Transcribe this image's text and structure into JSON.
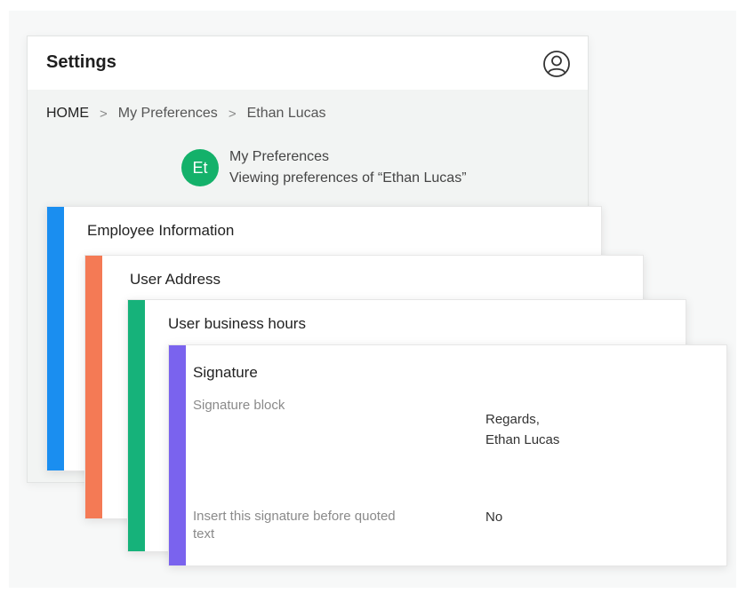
{
  "settings": {
    "title": "Settings"
  },
  "breadcrumb": {
    "items": [
      "HOME",
      "My Preferences",
      "Ethan Lucas"
    ],
    "separator": ">"
  },
  "profile": {
    "initials": "Et",
    "heading": "My Preferences",
    "subtitle": "Viewing preferences of “Ethan Lucas”",
    "avatar_color": "#14b16a"
  },
  "cards": {
    "employee": {
      "title": "Employee Information",
      "accent": "#1a8ef0"
    },
    "address": {
      "title": "User Address",
      "accent": "#f47a55"
    },
    "hours": {
      "title": "User business hours",
      "accent": "#16b27a"
    },
    "signature": {
      "title": "Signature",
      "accent": "#7a63ee",
      "block_label": "Signature block",
      "block_value": "Regards,\nEthan Lucas",
      "insert_label": "Insert this signature before quoted text",
      "insert_value": "No"
    }
  },
  "icons": {
    "header_avatar": "user-circle-icon"
  }
}
